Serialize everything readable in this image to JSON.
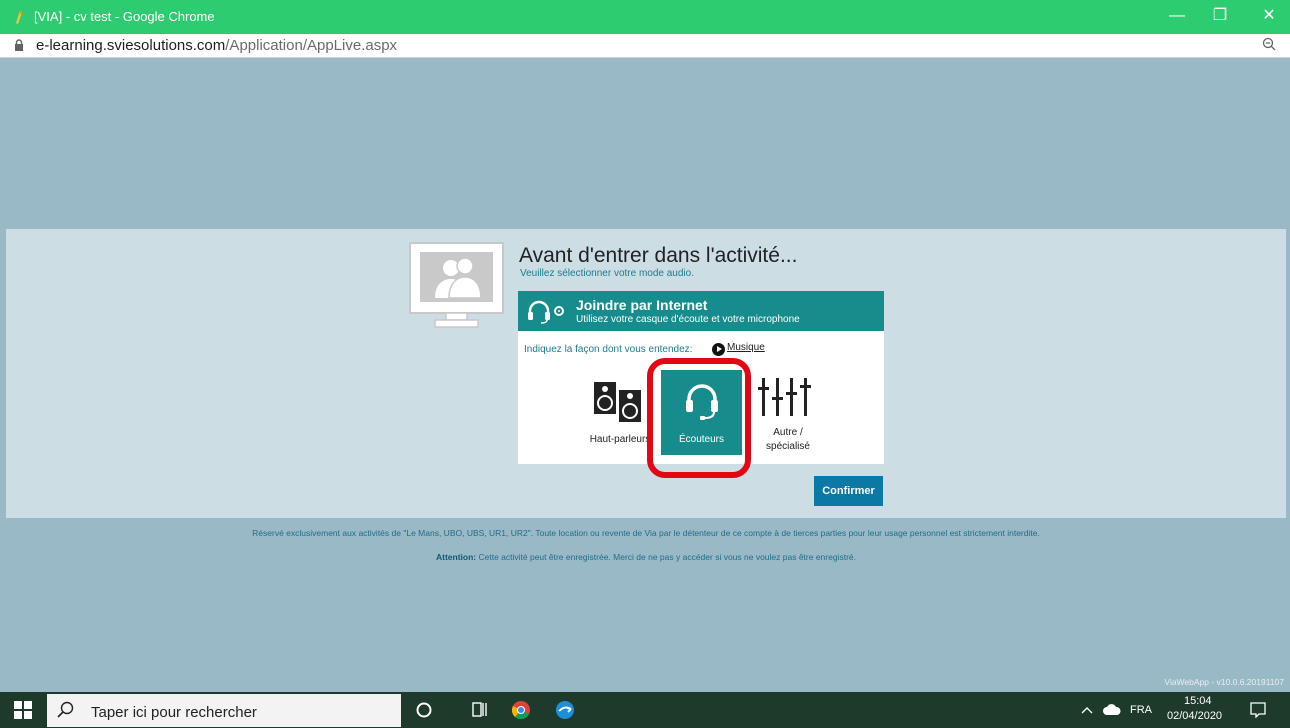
{
  "browser": {
    "window_title": "[VIA] - cv test - Google Chrome",
    "url_host": "e-learning.sviesolutions.com",
    "url_path": "/Application/AppLive.aspx",
    "minimize": "—",
    "restore": "❐",
    "close": "✕"
  },
  "page": {
    "heading": "Avant d'entrer dans l'activité...",
    "subheading": "Veuillez sélectionner votre mode audio.",
    "panel": {
      "title": "Joindre par Internet",
      "description": "Utilisez votre casque d'écoute et votre microphone",
      "hint": "Indiquez la façon dont vous entendez:",
      "music_link": "Musique",
      "options": [
        {
          "label": "Haut-parleurs",
          "selected": false
        },
        {
          "label": "Écouteurs",
          "selected": true
        },
        {
          "label": "Autre /",
          "label2": "spécialisé",
          "selected": false
        }
      ]
    },
    "confirm_label": "Confirmer",
    "legal_line1": "Réservé exclusivement aux activités de \"Le Mans, UBO, UBS, UR1, UR2\". Toute location ou revente de Via par le détenteur de ce compte à de tierces parties pour leur usage personnel est strictement interdite.",
    "legal_attention": "Attention:",
    "legal_line2": " Cette activité peut être enregistrée. Merci de ne pas y accéder si vous ne voulez pas être enregistré.",
    "version": "ViaWebApp - v10.0.6.20191107"
  },
  "taskbar": {
    "search_placeholder": "Taper ici pour rechercher",
    "language": "FRA",
    "time": "15:04",
    "date": "02/04/2020"
  },
  "colors": {
    "chrome_green": "#2ecc71",
    "teal": "#168c8c",
    "confirm_blue": "#0b78a6",
    "highlight_red": "#e30613"
  }
}
